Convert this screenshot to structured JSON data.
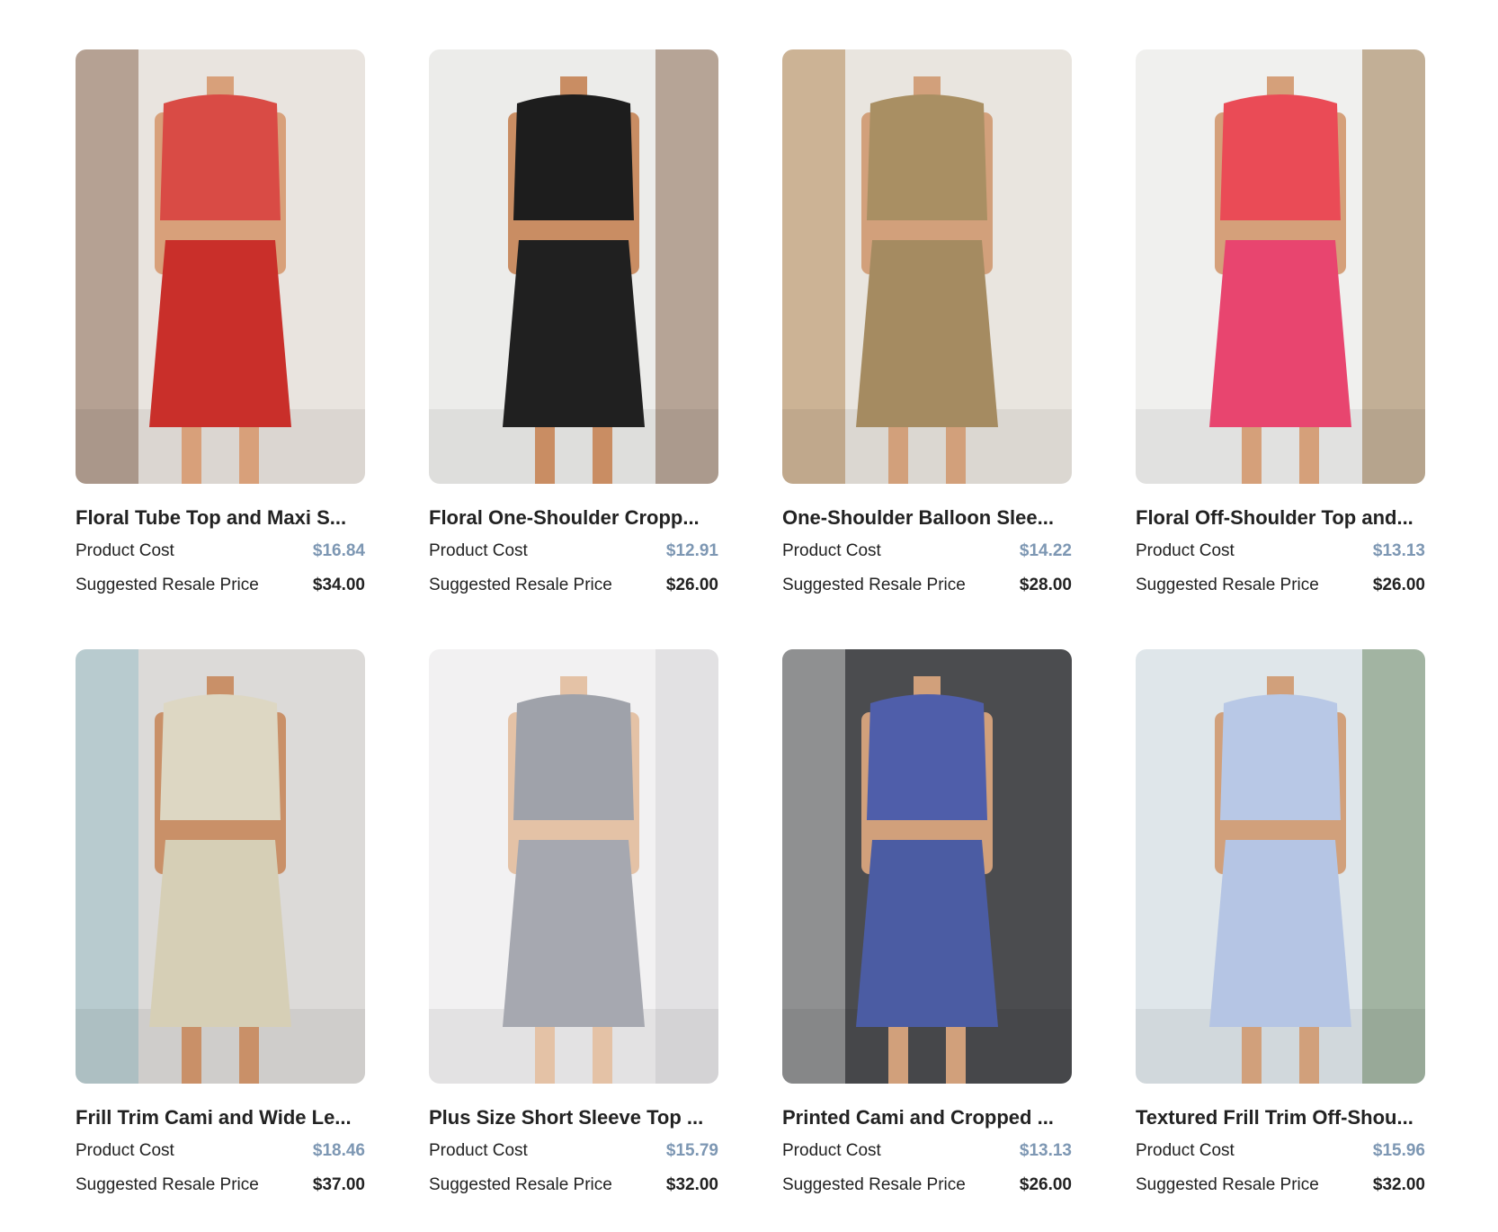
{
  "labels": {
    "product_cost": "Product Cost",
    "suggested_resale": "Suggested Resale Price"
  },
  "colors": {
    "cost_price": "#7d97b3",
    "text": "#222222"
  },
  "products": [
    {
      "title": "Floral Tube Top and Maxi S...",
      "product_cost": "$16.84",
      "suggested_resale_price": "$34.00",
      "image": {
        "bg": "#e9e4df",
        "accent": "#8a6a54",
        "top": "#d94b45",
        "bottom": "#c92f2a",
        "skin": "#d8a07a"
      }
    },
    {
      "title": "Floral One-Shoulder Cropp...",
      "product_cost": "$12.91",
      "suggested_resale_price": "$26.00",
      "image": {
        "bg": "#ececea",
        "accent": "#8b6a50",
        "top": "#1d1d1d",
        "bottom": "#202020",
        "skin": "#c98d63"
      }
    },
    {
      "title": "One-Shoulder Balloon Slee...",
      "product_cost": "$14.22",
      "suggested_resale_price": "$28.00",
      "image": {
        "bg": "#e9e5df",
        "accent": "#b58b58",
        "top": "#a98f63",
        "bottom": "#a58b61",
        "skin": "#d2a07b"
      }
    },
    {
      "title": "Floral Off-Shoulder Top and...",
      "product_cost": "$13.13",
      "suggested_resale_price": "$26.00",
      "image": {
        "bg": "#f0f0ee",
        "accent": "#9c7a4f",
        "top": "#ea4b56",
        "bottom": "#e8456f",
        "skin": "#d5a07a"
      }
    },
    {
      "title": "Frill Trim Cami and Wide Le...",
      "product_cost": "$18.46",
      "suggested_resale_price": "$37.00",
      "image": {
        "bg": "#dcdad8",
        "accent": "#9bbfc8",
        "top": "#ddd7c3",
        "bottom": "#d6cfb6",
        "skin": "#c99068"
      }
    },
    {
      "title": "Plus Size Short Sleeve Top ...",
      "product_cost": "$15.79",
      "suggested_resale_price": "$32.00",
      "image": {
        "bg": "#f2f1f2",
        "accent": "#d6d4d7",
        "top": "#9fa2aa",
        "bottom": "#a6a8b0",
        "skin": "#e4c2a6"
      }
    },
    {
      "title": "Printed Cami and Cropped ...",
      "product_cost": "$13.13",
      "suggested_resale_price": "$26.00",
      "image": {
        "bg": "#4b4c4f",
        "accent": "#c9c9c9",
        "top": "#4f5eaa",
        "bottom": "#4b5ca3",
        "skin": "#d1a07b"
      }
    },
    {
      "title": "Textured Frill Trim Off-Shou...",
      "product_cost": "$15.96",
      "suggested_resale_price": "$32.00",
      "image": {
        "bg": "#dfe6ea",
        "accent": "#6f8a66",
        "top": "#b8c8e6",
        "bottom": "#b5c5e4",
        "skin": "#d1a07b"
      }
    }
  ]
}
